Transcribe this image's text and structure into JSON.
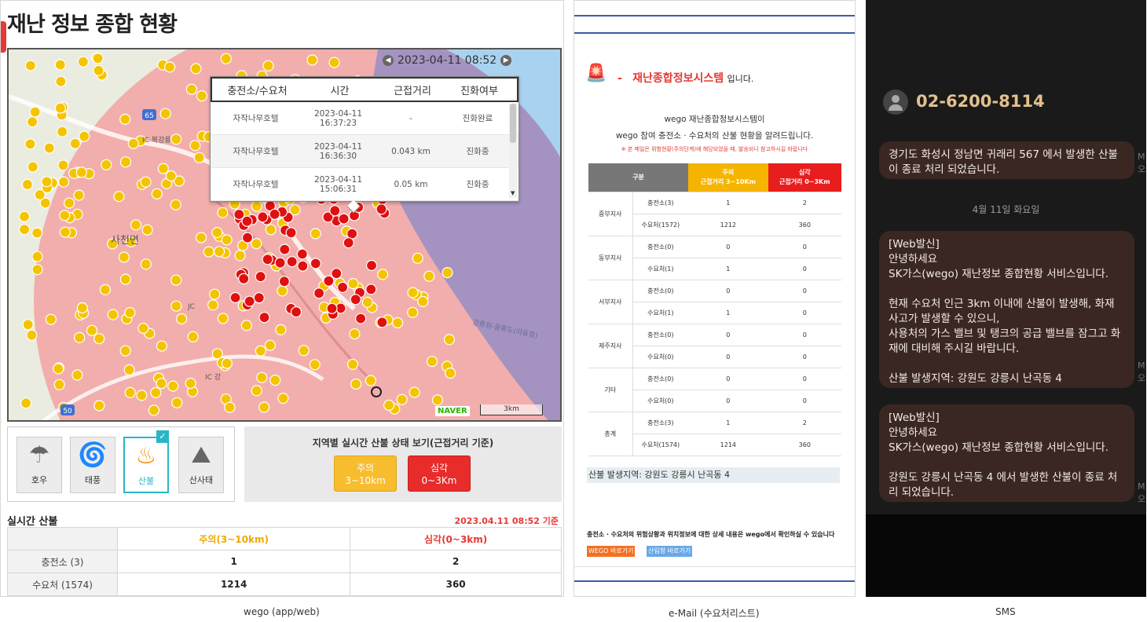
{
  "wego": {
    "title": "재난 정보 종합 현황",
    "map": {
      "datetime": "2023-04-11 08:52",
      "prev_icon": "chevron-left-icon",
      "next_icon": "chevron-right-icon",
      "popup": {
        "headers": [
          "충전소/수요처",
          "시간",
          "근접거리",
          "진화여부"
        ],
        "rows": [
          {
            "name": "자작나무호텔",
            "date": "2023-04-11",
            "time": "16:37:23",
            "distance": "-",
            "status": "진화완료"
          },
          {
            "name": "자작나무호텔",
            "date": "2023-04-11",
            "time": "16:36:30",
            "distance": "0.043 km",
            "status": "진화중"
          },
          {
            "name": "자작나무호텔",
            "date": "2023-04-11",
            "time": "15:06:31",
            "distance": "0.05 km",
            "status": "진화중"
          }
        ]
      },
      "place_label": "사천면",
      "naver_label": "NAVER",
      "scale_label": "3km",
      "road_label": "강릉원-울릉도(자동항)",
      "road_badges": [
        "65",
        "50"
      ],
      "ic_labels": [
        "IC 북강릉",
        "JC",
        "IC 강"
      ],
      "colors": {
        "critical_zone": "#f3a3a3",
        "warning_zone": "#a493c0",
        "sea": "#a9d2f0",
        "critical_dot": "#e01010",
        "warning_dot": "#f5c400"
      }
    },
    "disaster_types": [
      {
        "label": "호우",
        "icon": "heavy-rain-icon",
        "selected": false
      },
      {
        "label": "태풍",
        "icon": "typhoon-icon",
        "selected": false
      },
      {
        "label": "산불",
        "icon": "wildfire-icon",
        "selected": true
      },
      {
        "label": "산사태",
        "icon": "landslide-icon",
        "selected": false
      }
    ],
    "region": {
      "title": "지역별 실시간 산불 상태 보기(근접거리 기준)",
      "warn_label": "주의",
      "warn_range": "3~10km",
      "crit_label": "심각",
      "crit_range": "0~3Km"
    },
    "realtime": {
      "title": "실시간 산불",
      "date": "2023.04.11 08:52 기준",
      "headers": [
        "",
        "주의(3~10km)",
        "심각(0~3km)"
      ],
      "rows": [
        {
          "label": "충전소 (3)",
          "warn": "1",
          "crit": "2"
        },
        {
          "label": "수요처 (1574)",
          "warn": "1214",
          "crit": "360"
        }
      ]
    }
  },
  "email": {
    "logo_icon": "siren-icon",
    "dash": "-",
    "system_name": "재난종합정보시스템",
    "head_suffix": "입니다.",
    "intro1": "wego 재난종합정보시스템이",
    "intro2": "wego 참여 충전소 · 수요처의 산불 현황을 알려드립니다.",
    "note": "※ 본 메일은 위험현황(주의단계)에 해당되었을 때, 발송되니 참고하시길 바랍니다",
    "table_headers": {
      "group": "구분",
      "warn": "주의",
      "warn_sub": "근접거리 3~10Km",
      "crit": "심각",
      "crit_sub": "근접거리 0~3Km"
    },
    "table": [
      {
        "group": "중부지사",
        "rows": [
          {
            "type": "충전소(3)",
            "warn": "1",
            "crit": "2"
          },
          {
            "type": "수요처(1572)",
            "warn": "1212",
            "crit": "360"
          }
        ]
      },
      {
        "group": "동부지사",
        "rows": [
          {
            "type": "충전소(0)",
            "warn": "0",
            "crit": "0"
          },
          {
            "type": "수요처(1)",
            "warn": "1",
            "crit": "0"
          }
        ]
      },
      {
        "group": "서부지사",
        "rows": [
          {
            "type": "충전소(0)",
            "warn": "0",
            "crit": "0"
          },
          {
            "type": "수요처(1)",
            "warn": "1",
            "crit": "0"
          }
        ]
      },
      {
        "group": "제주지사",
        "rows": [
          {
            "type": "충전소(0)",
            "warn": "0",
            "crit": "0"
          },
          {
            "type": "수요처(0)",
            "warn": "0",
            "crit": "0"
          }
        ]
      },
      {
        "group": "기타",
        "rows": [
          {
            "type": "충전소(0)",
            "warn": "0",
            "crit": "0"
          },
          {
            "type": "수요처(0)",
            "warn": "0",
            "crit": "0"
          }
        ]
      },
      {
        "group": "총계",
        "rows": [
          {
            "type": "충전소(3)",
            "warn": "1",
            "crit": "2"
          },
          {
            "type": "수요처(1574)",
            "warn": "1214",
            "crit": "360"
          }
        ]
      }
    ],
    "area": "산불 발생지역: 강원도 강릉시 난곡동 4",
    "footer": "충전소 · 수요처의 위험상황과 위치정보에 대한 상세 내용은 wego에서 확인하실 수 있습니다",
    "btn_wego": "WEGO 바로가기",
    "btn_forest": "산림청 바로가기"
  },
  "sms": {
    "number": "02-6200-8114",
    "chevron_icon": "chevron-down-icon",
    "avatar_icon": "person-icon",
    "msg1": "경기도 화성시 정남면 귀래리 567 에서 발생한 산불이 종료 처리 되었습니다.",
    "date_divider": "4월 11일 화요일",
    "msg2": "[Web발신]\n안녕하세요\nSK가스(wego) 재난정보 종합현황 서비스입니다.\n\n현재 수요처 인근 3km 이내에 산불이 발생해, 화재 사고가 발생할 수 있으니,\n사용처의 가스 밸브 및 탱크의 공급 밸브를 잠그고 화재에 대비해 주시길 바랍니다.\n\n산불 발생지역: 강원도 강릉시 난곡동 4",
    "msg3": "[Web발신]\n안녕하세요\nSK가스(wego) 재난정보 종합현황 서비스입니다.\n\n강원도 강릉시 난곡동 4 에서 발생한 산불이 종료 처리 되었습니다.",
    "side_chars": [
      "M\n오",
      "M\n오",
      "M\n오"
    ]
  },
  "captions": [
    "wego (app/web)",
    "e-Mail (수요처리스트)",
    "SMS"
  ]
}
